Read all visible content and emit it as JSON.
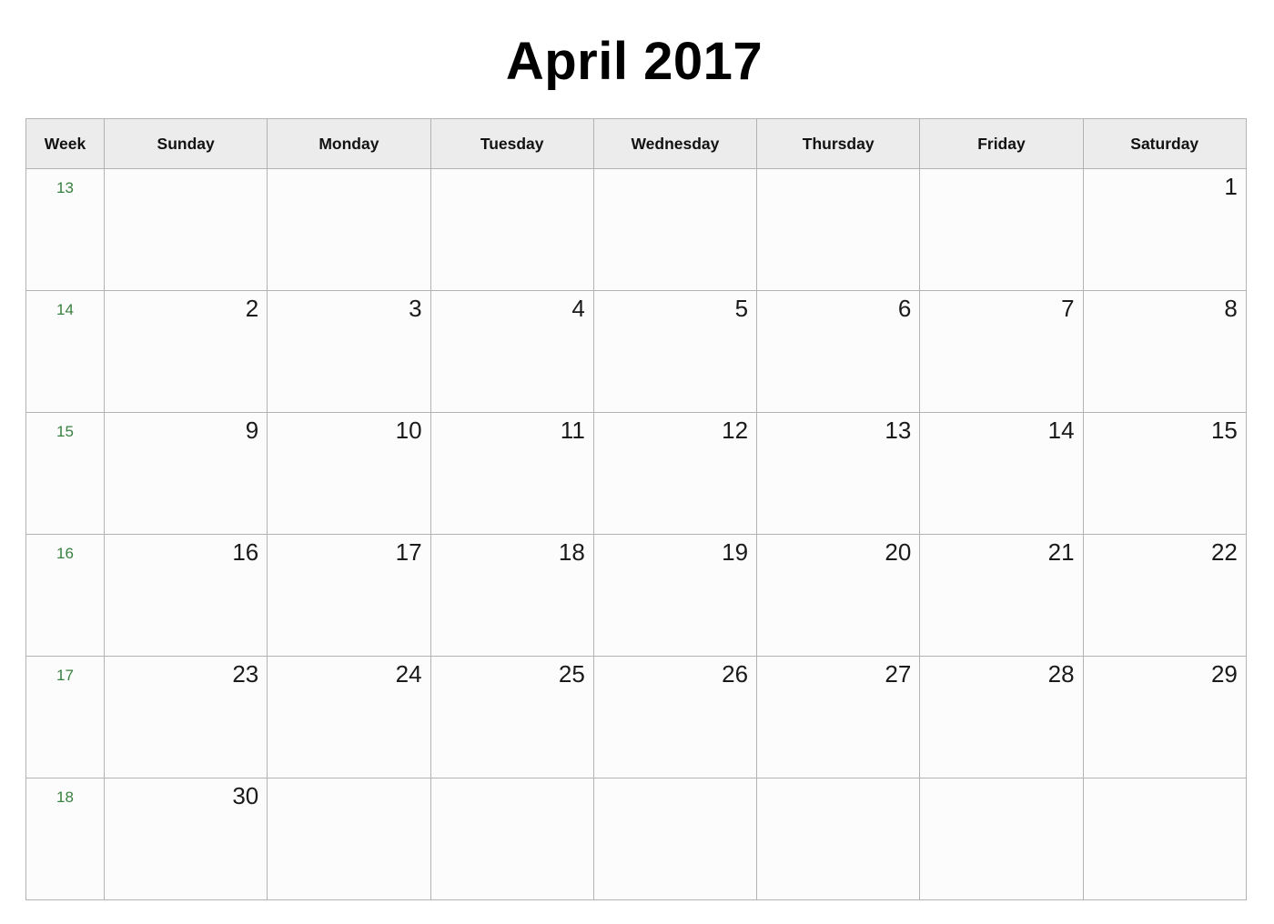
{
  "header": {
    "title": "April 2017"
  },
  "calendar": {
    "columns": [
      {
        "key": "week",
        "label": "Week"
      },
      {
        "key": "sunday",
        "label": "Sunday"
      },
      {
        "key": "monday",
        "label": "Monday"
      },
      {
        "key": "tuesday",
        "label": "Tuesday"
      },
      {
        "key": "wednesday",
        "label": "Wednesday"
      },
      {
        "key": "thursday",
        "label": "Thursday"
      },
      {
        "key": "friday",
        "label": "Friday"
      },
      {
        "key": "saturday",
        "label": "Saturday"
      }
    ],
    "week_number_color": "#38803f",
    "header_background": "#ececec",
    "grid_line_color": "#b3b3b3",
    "cell_background": "#fcfcfc",
    "rows": [
      {
        "week": "13",
        "days": [
          "",
          "",
          "",
          "",
          "",
          "",
          "1"
        ]
      },
      {
        "week": "14",
        "days": [
          "2",
          "3",
          "4",
          "5",
          "6",
          "7",
          "8"
        ]
      },
      {
        "week": "15",
        "days": [
          "9",
          "10",
          "11",
          "12",
          "13",
          "14",
          "15"
        ]
      },
      {
        "week": "16",
        "days": [
          "16",
          "17",
          "18",
          "19",
          "20",
          "21",
          "22"
        ]
      },
      {
        "week": "17",
        "days": [
          "23",
          "24",
          "25",
          "26",
          "27",
          "28",
          "29"
        ]
      },
      {
        "week": "18",
        "days": [
          "30",
          "",
          "",
          "",
          "",
          "",
          ""
        ]
      }
    ]
  }
}
